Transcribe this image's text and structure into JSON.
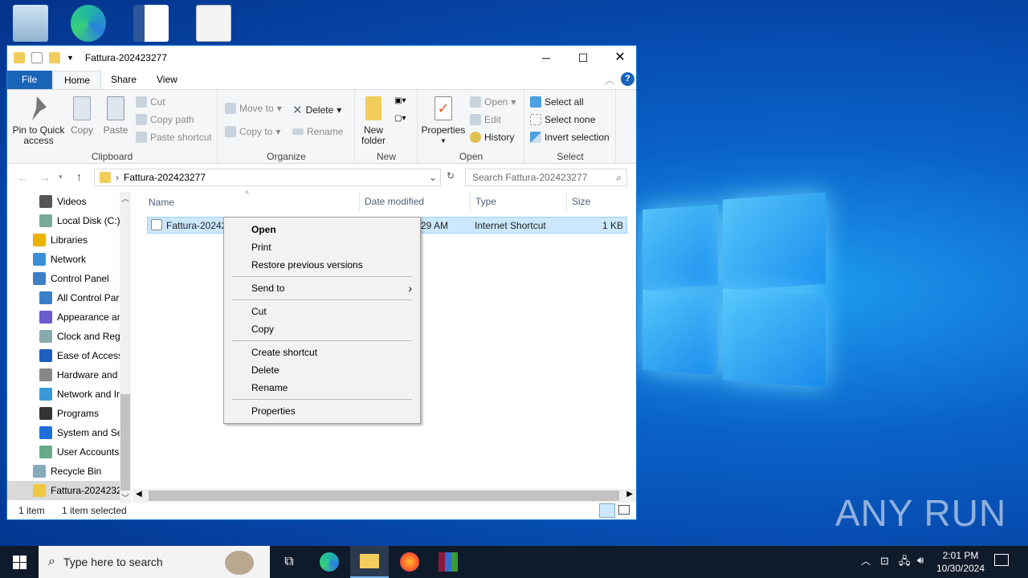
{
  "window": {
    "title": "Fattura-202423277"
  },
  "ribbon_tabs": [
    "File",
    "Home",
    "Share",
    "View"
  ],
  "clipboard": {
    "pin": "Pin to Quick access",
    "pin1": "Pin to Quick",
    "pin2": "access",
    "copy": "Copy",
    "paste": "Paste",
    "cut": "Cut",
    "copy_path": "Copy path",
    "paste_shortcut": "Paste shortcut",
    "label": "Clipboard"
  },
  "organize": {
    "move_to": "Move to",
    "copy_to": "Copy to",
    "delete": "Delete",
    "rename": "Rename",
    "label": "Organize"
  },
  "new": {
    "new1": "New",
    "new2": "folder",
    "label": "New"
  },
  "open": {
    "properties": "Properties",
    "open": "Open",
    "edit": "Edit",
    "history": "History",
    "label": "Open"
  },
  "select": {
    "all": "Select all",
    "none": "Select none",
    "invert": "Invert selection",
    "label": "Select"
  },
  "address": {
    "path": "Fattura-202423277",
    "search_placeholder": "Search Fattura-202423277"
  },
  "nav": [
    {
      "label": "Videos",
      "indent": 2,
      "color": "#555"
    },
    {
      "label": "Local Disk (C:)",
      "indent": 2,
      "color": "#7a9"
    },
    {
      "label": "Libraries",
      "indent": 1,
      "color": "#e8b400"
    },
    {
      "label": "Network",
      "indent": 1,
      "color": "#3a8ed8"
    },
    {
      "label": "Control Panel",
      "indent": 1,
      "color": "#3a7fc8"
    },
    {
      "label": "All Control Par",
      "indent": 2,
      "color": "#3a7fc8"
    },
    {
      "label": "Appearance an",
      "indent": 2,
      "color": "#6a5acd"
    },
    {
      "label": "Clock and Regi",
      "indent": 2,
      "color": "#8aa"
    },
    {
      "label": "Ease of Access",
      "indent": 2,
      "color": "#1f5fbf"
    },
    {
      "label": "Hardware and",
      "indent": 2,
      "color": "#888"
    },
    {
      "label": "Network and Ir",
      "indent": 2,
      "color": "#3a9ad8"
    },
    {
      "label": "Programs",
      "indent": 2,
      "color": "#333"
    },
    {
      "label": "System and Sec",
      "indent": 2,
      "color": "#1f6fd8"
    },
    {
      "label": "User Accounts",
      "indent": 2,
      "color": "#6a8"
    },
    {
      "label": "Recycle Bin",
      "indent": 1,
      "color": "#8ab"
    },
    {
      "label": "Fattura-2024232",
      "indent": 1,
      "color": "#f0c840",
      "selected": true
    }
  ],
  "columns": {
    "name": "Name",
    "date": "Date modified",
    "type": "Type",
    "size": "Size"
  },
  "file": {
    "name": "Fattura-20242",
    "date": "29 AM",
    "type": "Internet Shortcut",
    "size": "1 KB"
  },
  "context_menu": [
    {
      "label": "Open",
      "bold": true
    },
    {
      "label": "Print"
    },
    {
      "label": "Restore previous versions"
    },
    {
      "sep": true
    },
    {
      "label": "Send to",
      "submenu": true
    },
    {
      "sep": true
    },
    {
      "label": "Cut"
    },
    {
      "label": "Copy"
    },
    {
      "sep": true
    },
    {
      "label": "Create shortcut"
    },
    {
      "label": "Delete"
    },
    {
      "label": "Rename"
    },
    {
      "sep": true
    },
    {
      "label": "Properties"
    }
  ],
  "status": {
    "count": "1 item",
    "selected": "1 item selected"
  },
  "taskbar": {
    "search_placeholder": "Type here to search",
    "time": "2:01 PM",
    "date": "10/30/2024"
  },
  "watermark": "ANY RUN"
}
